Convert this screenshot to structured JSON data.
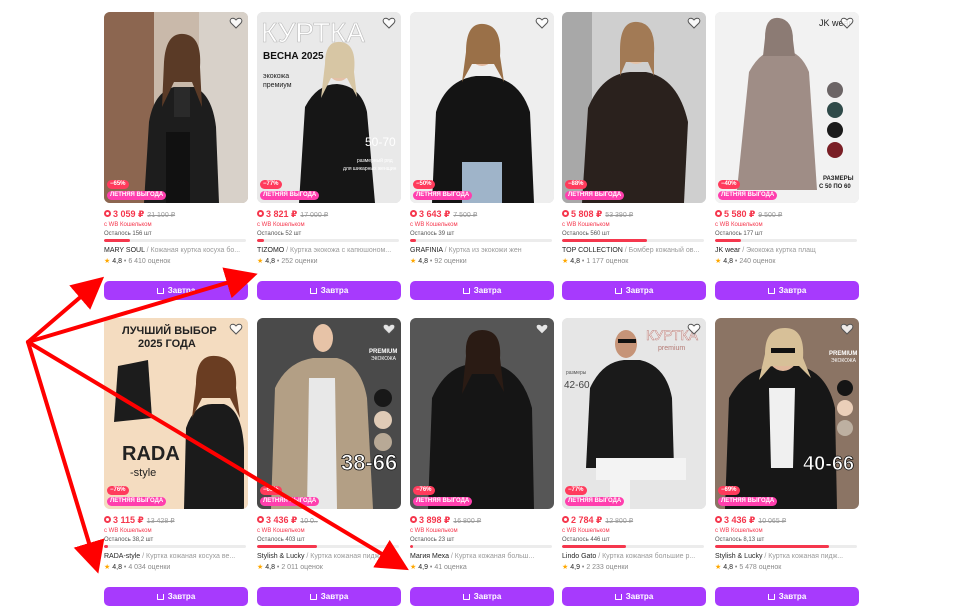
{
  "rows": [
    {
      "cards": [
        {
          "discount": "−65%",
          "promo": "ЛЕТНЯЯ ВЫГОДА",
          "price": "3 059 ₽",
          "old_price": "21 100 ₽",
          "wallet": "с WB Кошельком",
          "stock": "Осталось 156 шт",
          "stock_level": 0.18,
          "brand": "MARY SOUL",
          "title": " / Кожаная куртка косуха бо...",
          "rating": "4,8",
          "reviews": "6 410 оценок",
          "button": "Завтра",
          "image": "woman-black-leather-jacket"
        },
        {
          "discount": "−77%",
          "promo": "ЛЕТНЯЯ ВЫГОДА",
          "price": "3 821 ₽",
          "old_price": "17 000 ₽",
          "wallet": "с WB Кошельком",
          "stock": "Осталось 52 шт",
          "stock_level": 0.05,
          "brand": "TIZOMO",
          "title": " / Куртка экокожа с капюшоном...",
          "rating": "4,8",
          "reviews": "252 оценки",
          "button": "Завтра",
          "image": "kurtka-vesna-2025",
          "overlay": {
            "headline": "КУРТКА",
            "sub": "ВЕСНА 2025",
            "material": "экокожа",
            "grade": "премиум",
            "sizes": "50-70",
            "size_note": "размерный ряд",
            "size_note2": "для шикарных женщин"
          }
        },
        {
          "discount": "−50%",
          "promo": "ЛЕТНЯЯ ВЫГОДА",
          "price": "3 643 ₽",
          "old_price": "7 500 ₽",
          "wallet": "с WB Кошельком",
          "stock": "Осталось 39 шт",
          "stock_level": 0.04,
          "brand": "GRAFINIA",
          "title": " / Куртка из экокожи жен",
          "rating": "4,8",
          "reviews": "92 оценки",
          "button": "Завтра",
          "image": "woman-black-jacket-jeans"
        },
        {
          "discount": "−88%",
          "promo": "ЛЕТНЯЯ ВЫГОДА",
          "price": "5 808 ₽",
          "old_price": "53 390 ₽",
          "wallet": "с WB Кошельком",
          "stock": "Осталось 560 шт",
          "stock_level": 0.6,
          "brand": "TOP COLLECTION",
          "title": " / Бомбер кожаный ов...",
          "rating": "4,8",
          "reviews": "1 177 оценок",
          "button": "Завтра",
          "image": "woman-oversize-leather"
        },
        {
          "discount": "−40%",
          "promo": "ЛЕТНЯЯ ВЫГОДА",
          "price": "5 580 ₽",
          "old_price": "9 500 ₽",
          "wallet": "с WB Кошельком",
          "stock": "Осталось 177 шт",
          "stock_level": 0.18,
          "brand": "JK wear",
          "title": " / Экокожа куртка плащ",
          "rating": "4,8",
          "reviews": "240 оценок",
          "button": "Завтра",
          "image": "woman-grey-coat",
          "overlay": {
            "logo": "JK wear",
            "sizes_label": "РАЗМЕРЫ",
            "sizes_range": "С 50 ПО 60"
          }
        }
      ]
    },
    {
      "cards": [
        {
          "discount": "−76%",
          "promo": "ЛЕТНЯЯ ВЫГОДА",
          "price": "3 115 ₽",
          "old_price": "13 428 ₽",
          "wallet": "с WB Кошельком",
          "stock": "Осталось 38,2 шт",
          "stock_level": 0.03,
          "brand": "RADA-style",
          "title": " / Куртка кожаная косуха ве...",
          "rating": "4,8",
          "reviews": "4 034 оценки",
          "button": "Завтра",
          "image": "cartoon-rada",
          "overlay": {
            "headline": "ЛУЧШИЙ ВЫБОР",
            "headline2": "2025 ГОДА",
            "brand_big": "RADA",
            "brand_small": "-style"
          }
        },
        {
          "discount": "−65%",
          "promo": "ЛЕТНЯЯ ВЫГОДА",
          "price": "3 436 ₽",
          "old_price": "10 0..",
          "wallet": "с WB Кошельком",
          "stock": "Осталось 403 шт",
          "stock_level": 0.42,
          "brand": "Stylish & Lucky",
          "title": " / Куртка кожаная пидж...",
          "rating": "4,8",
          "reviews": "2 011 оценок",
          "button": "Завтра",
          "image": "beige-leather-jacket",
          "overlay": {
            "premium": "PREMIUM",
            "premium_sub": "ЭКОКОЖА",
            "sizes": "38-66"
          }
        },
        {
          "discount": "−76%",
          "promo": "ЛЕТНЯЯ ВЫГОДА",
          "price": "3 898 ₽",
          "old_price": "16 800 ₽",
          "wallet": "с WB Кошельком",
          "stock": "Осталось 23 шт",
          "stock_level": 0.02,
          "brand": "Магия Меха",
          "title": " / Куртка кожаная больш...",
          "rating": "4,9",
          "reviews": "41 оценка",
          "button": "Завтра",
          "image": "woman-hooded-black"
        },
        {
          "discount": "−77%",
          "promo": "ЛЕТНЯЯ ВЫГОДА",
          "price": "2 784 ₽",
          "old_price": "12 800 ₽",
          "wallet": "с WB Кошельком",
          "stock": "Осталось 446 шт",
          "stock_level": 0.45,
          "brand": "Lindo Gato",
          "title": " / Куртка кожаная большие р...",
          "rating": "4,9",
          "reviews": "2 233 оценки",
          "button": "Завтра",
          "image": "kurtka-premium",
          "overlay": {
            "headline": "КУРТКА",
            "sub": "premium",
            "sizes_label": "размеры",
            "sizes": "42-60"
          }
        },
        {
          "discount": "−69%",
          "promo": "ЛЕТНЯЯ ВЫГОДА",
          "price": "3 436 ₽",
          "old_price": "10 065 ₽",
          "wallet": "с WB Кошельком",
          "stock": "Осталось 8,13 шт",
          "stock_level": 0.8,
          "brand": "Stylish & Lucky",
          "title": " / Куртка кожаная пидж...",
          "rating": "4,8",
          "reviews": "5 478 оценок",
          "button": "Завтра",
          "image": "woman-black-blazer",
          "overlay": {
            "premium": "PREMIUM",
            "premium_sub": "ЭКОКОЖА",
            "sizes": "40-66"
          }
        }
      ]
    }
  ],
  "colors": {
    "accent": "#a73afd",
    "price": "#f5374d",
    "promo": "#ff3fae",
    "arrow": "#ff0000"
  }
}
